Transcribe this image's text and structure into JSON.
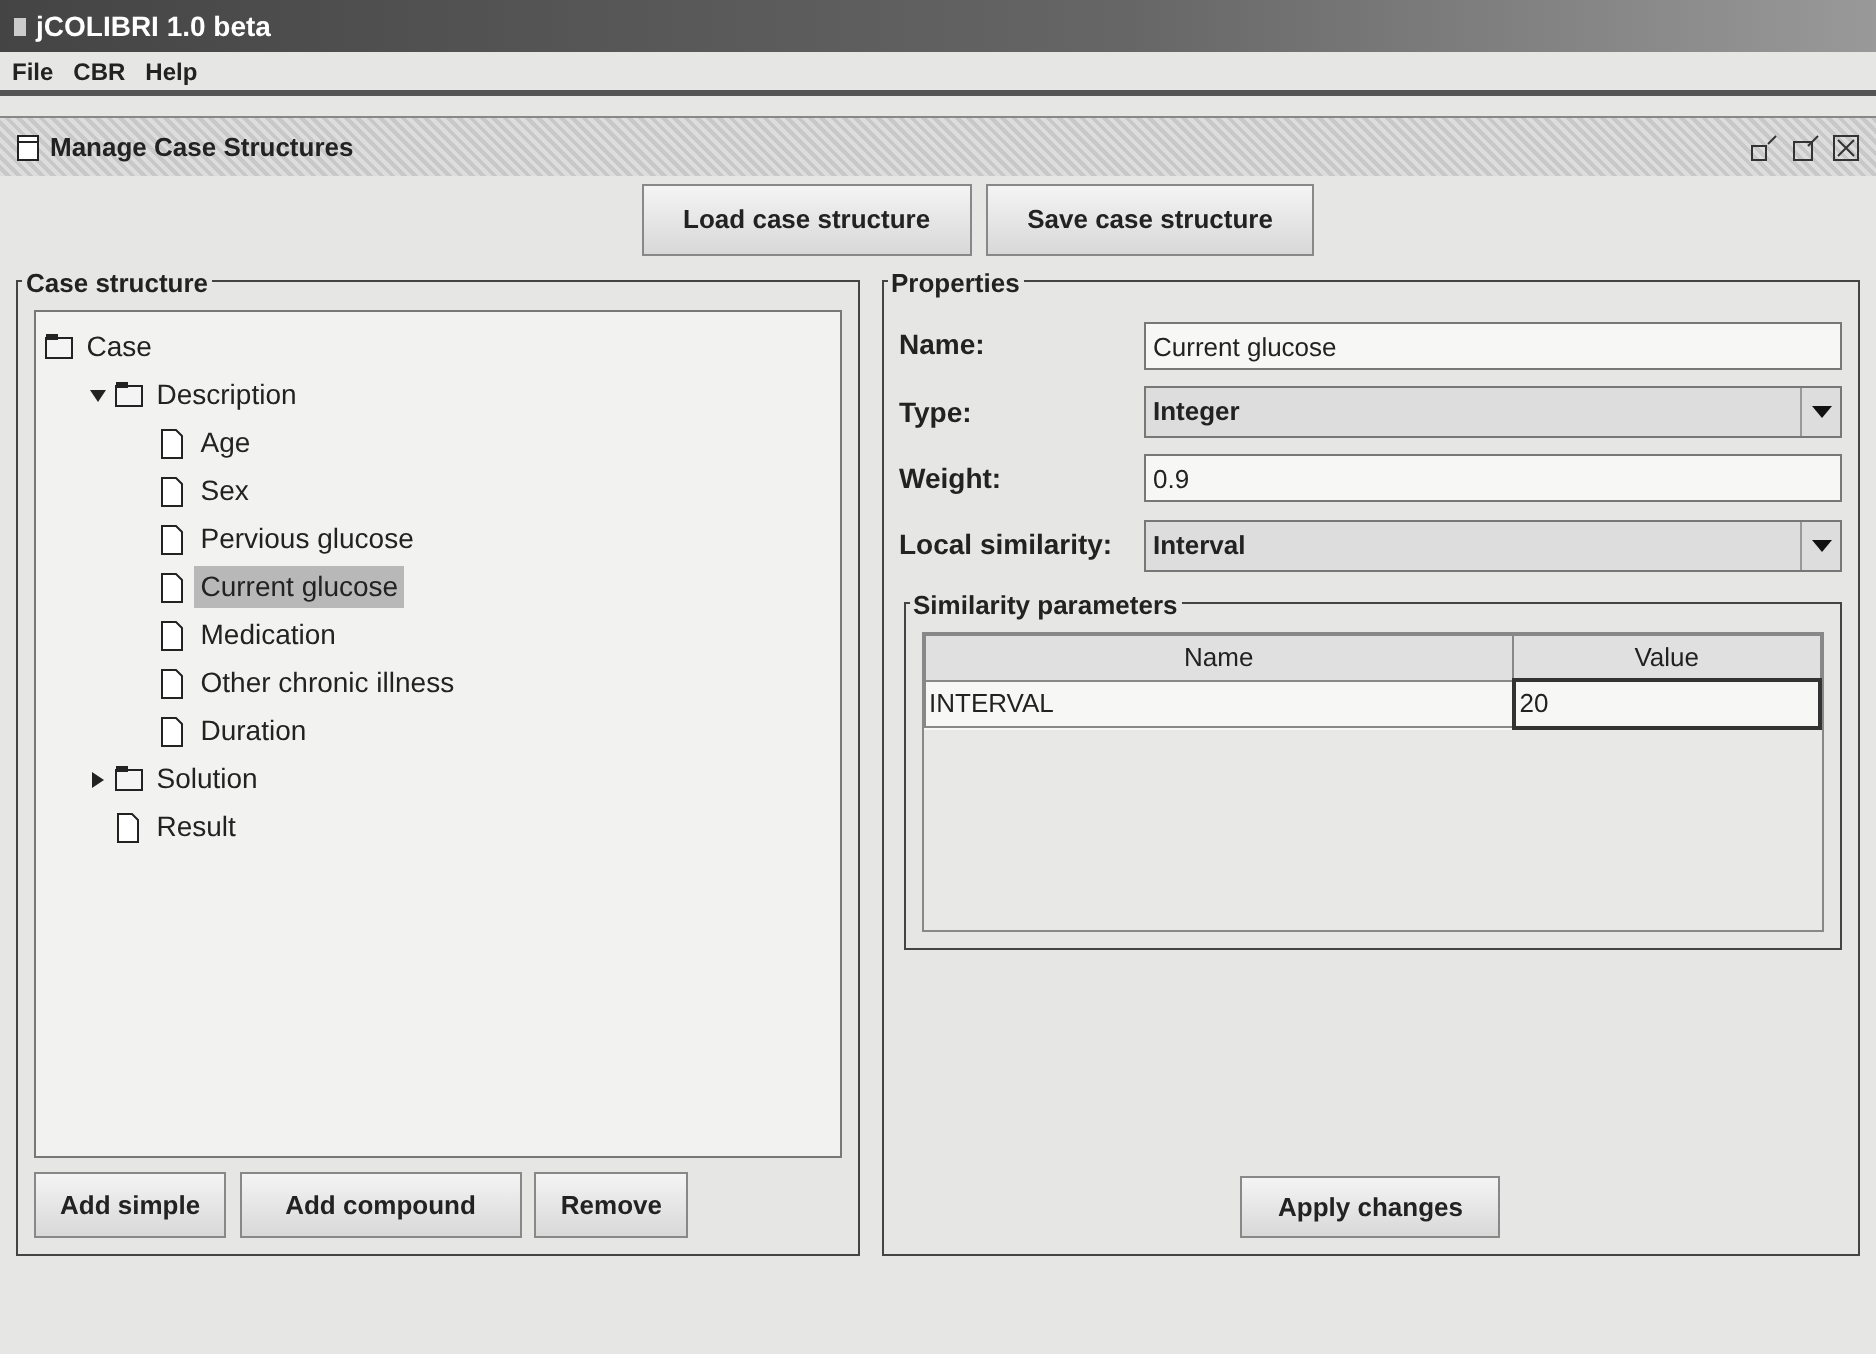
{
  "window": {
    "title": "jCOLIBRI 1.0 beta"
  },
  "menu": [
    "File",
    "CBR",
    "Help"
  ],
  "frame": {
    "title": "Manage Case Structures"
  },
  "top_buttons": [
    "Load case structure",
    "Save case structure"
  ],
  "case_structure": {
    "title": "Case structure",
    "tree": [
      {
        "label": "Case",
        "kind": "folder",
        "selected": false,
        "children": [
          {
            "label": "Description",
            "kind": "folder",
            "expanded": true,
            "selected": false,
            "children": [
              {
                "label": "Age",
                "kind": "leaf",
                "selected": false
              },
              {
                "label": "Sex",
                "kind": "leaf",
                "selected": false
              },
              {
                "label": "Pervious glucose",
                "kind": "leaf",
                "selected": false
              },
              {
                "label": "Current glucose",
                "kind": "leaf",
                "selected": true
              },
              {
                "label": "Medication",
                "kind": "leaf",
                "selected": false
              },
              {
                "label": "Other chronic illness",
                "kind": "leaf",
                "selected": false
              },
              {
                "label": "Duration",
                "kind": "leaf",
                "selected": false
              }
            ]
          },
          {
            "label": "Solution",
            "kind": "folder",
            "expanded": false,
            "selected": false
          },
          {
            "label": "Result",
            "kind": "leaf",
            "selected": false
          }
        ]
      }
    ],
    "buttons": [
      "Add simple",
      "Add compound",
      "Remove"
    ]
  },
  "properties": {
    "title": "Properties",
    "fields": [
      {
        "label": "Name:",
        "kind": "text",
        "value": "Current glucose"
      },
      {
        "label": "Type:",
        "kind": "combo",
        "value": "Integer"
      },
      {
        "label": "Weight:",
        "kind": "text",
        "value": "0.9"
      },
      {
        "label": "Local similarity:",
        "kind": "combo",
        "value": "Interval"
      }
    ],
    "similarity_parameters": {
      "title": "Similarity parameters",
      "columns": [
        "Name",
        "Value"
      ],
      "rows": [
        [
          "INTERVAL",
          "20"
        ]
      ]
    },
    "apply_button": "Apply changes"
  }
}
